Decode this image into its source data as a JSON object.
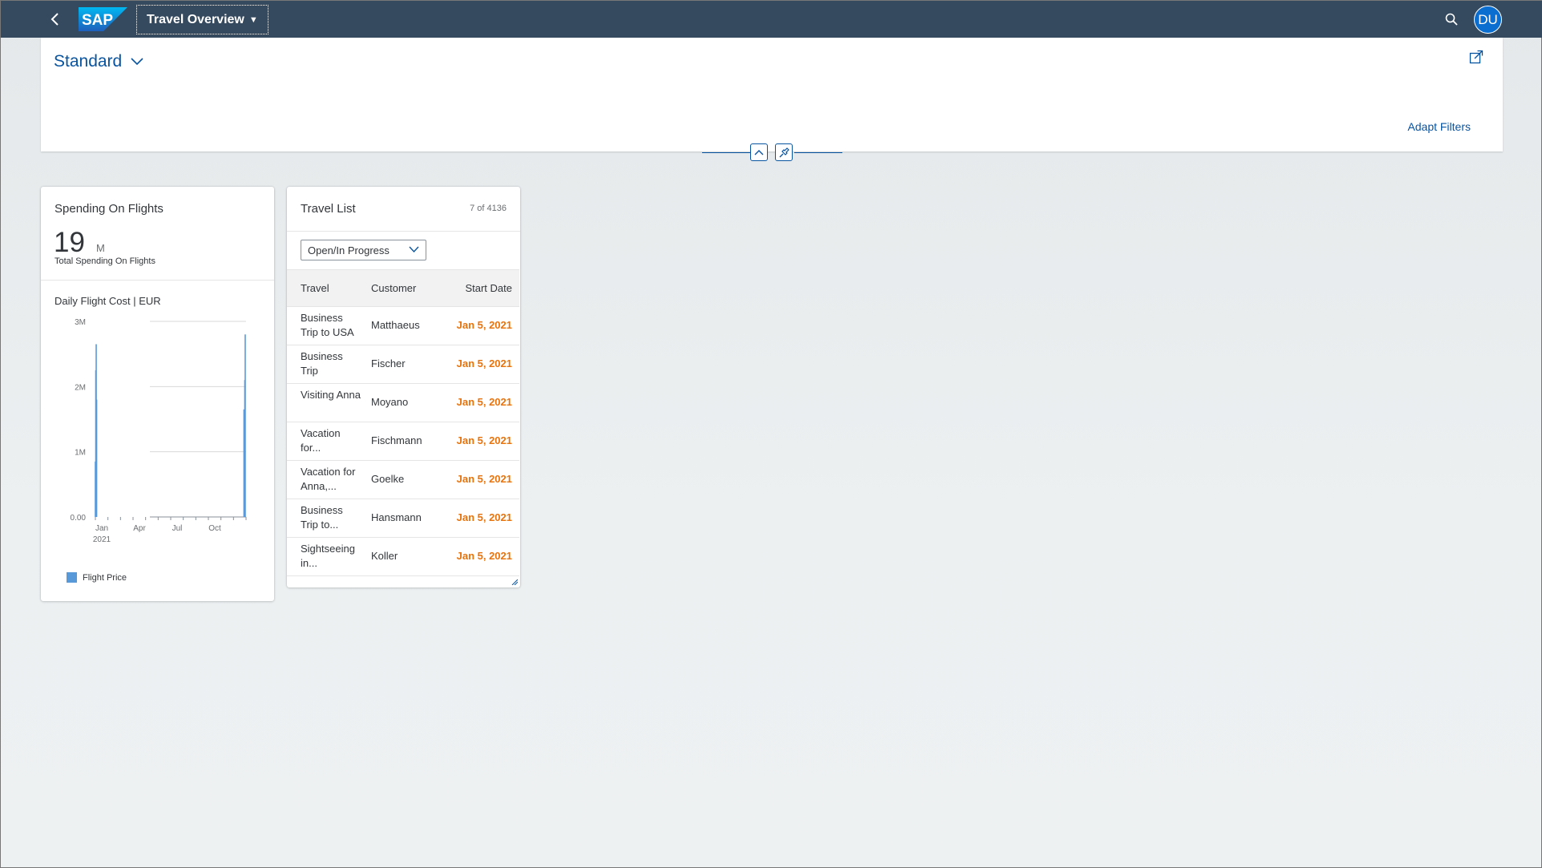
{
  "shell": {
    "logo_text": "SAP",
    "app_title": "Travel Overview",
    "avatar_initials": "DU",
    "brand_color": "#354a5f",
    "icons": [
      "back-icon",
      "search-icon"
    ]
  },
  "filter_bar": {
    "variant": "Standard",
    "adapt_filters": "Adapt Filters",
    "icons": [
      "share-icon",
      "collapse-icon",
      "pin-icon"
    ]
  },
  "spending_card": {
    "title": "Spending On Flights",
    "kpi_value": "19",
    "kpi_unit": "M",
    "kpi_subtitle": "Total Spending On Flights",
    "chart_title": "Daily Flight Cost | EUR",
    "legend_label": "Flight Price",
    "legend_color": "#5899da"
  },
  "chart_data": {
    "type": "bar",
    "title": "Daily Flight Cost | EUR",
    "y_ticks": [
      "3M",
      "2M",
      "1M",
      "0.00"
    ],
    "ylim": [
      0,
      3000000
    ],
    "x_ticks": [
      "Jan",
      "Apr",
      "Jul",
      "Oct"
    ],
    "x_year_label": "2021",
    "series": [
      {
        "name": "Flight Price",
        "color": "#5899da",
        "points": [
          {
            "day": 1,
            "value": 850000
          },
          {
            "day": 2,
            "value": 2250000
          },
          {
            "day": 3,
            "value": 2650000
          },
          {
            "day": 4,
            "value": 1800000
          },
          {
            "day": 360,
            "value": 1650000
          },
          {
            "day": 361,
            "value": 650000
          },
          {
            "day": 362,
            "value": 2100000
          },
          {
            "day": 363,
            "value": 2800000
          }
        ]
      }
    ]
  },
  "travel_card": {
    "title": "Travel List",
    "count": "7 of 4136",
    "filter_value": "Open/In Progress",
    "columns": [
      "Travel",
      "Customer",
      "Start Date"
    ],
    "rows": [
      {
        "travel": "Business Trip to USA",
        "customer": "Matthaeus",
        "start": "Jan 5, 2021"
      },
      {
        "travel": "Business Trip",
        "customer": "Fischer",
        "start": "Jan 5, 2021"
      },
      {
        "travel": "Visiting Anna",
        "customer": "Moyano",
        "start": "Jan 5, 2021"
      },
      {
        "travel": "Vacation for...",
        "customer": "Fischmann",
        "start": "Jan 5, 2021"
      },
      {
        "travel": "Vacation for Anna,...",
        "customer": "Goelke",
        "start": "Jan 5, 2021"
      },
      {
        "travel": "Business Trip to...",
        "customer": "Hansmann",
        "start": "Jan 5, 2021"
      },
      {
        "travel": "Sightseeing in...",
        "customer": "Koller",
        "start": "Jan 5, 2021"
      }
    ],
    "date_color": "#e9730c"
  }
}
